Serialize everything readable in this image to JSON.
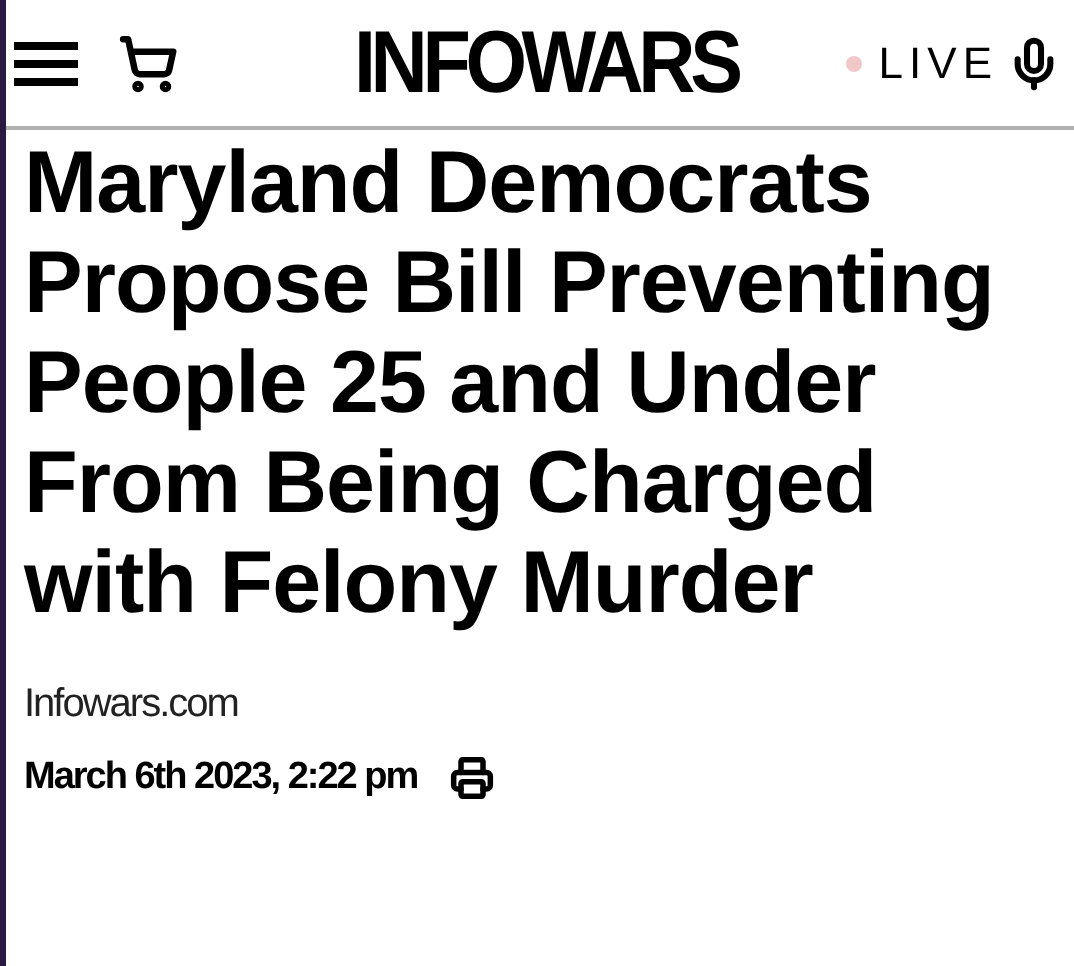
{
  "header": {
    "logo": "INFOWARS",
    "live": {
      "label": "LIVE",
      "on": false
    }
  },
  "article": {
    "headline": "Maryland Democrats Propose Bill Preventing People 25 and Under From Being Charged with Felony Murder",
    "source": "Infowars.com",
    "date": "March 6th 2023, 2:22 pm"
  }
}
